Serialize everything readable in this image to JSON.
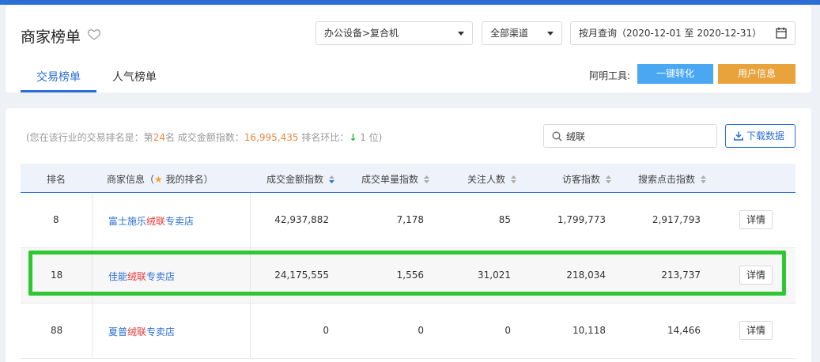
{
  "header": {
    "title": "商家榜单",
    "category_select": "办公设备>复合机",
    "channel_select": "全部渠道",
    "date_select": "按月查询（2020-12-01 至 2020-12-31）",
    "tabs": [
      {
        "label": "交易榜单",
        "active": true
      },
      {
        "label": "人气榜单",
        "active": false
      }
    ],
    "tools_label": "阿明工具:",
    "btn_convert": "一键转化",
    "btn_userinfo": "用户信息"
  },
  "summary": {
    "prefix": "(您在该行业的交易排名是：第",
    "rank": "24",
    "rank_suffix": "名   成交金额指数：",
    "amount": "16,995,435",
    "ratio_label": "   排名环比：",
    "ratio_arrow": "↓",
    "ratio_value": " 1 位)"
  },
  "search": {
    "value": "绒联"
  },
  "download_label": "下载数据",
  "table": {
    "headers": {
      "rank": "排名",
      "merchant": "商家信息（",
      "merchant_suffix": " 我的排名）",
      "amount": "成交金额指数",
      "orders": "成交单量指数",
      "followers": "关注人数",
      "visitors": "访客指数",
      "search_clicks": "搜索点击指数"
    },
    "rows": [
      {
        "rank": "8",
        "shop_pre": "富士施乐",
        "shop_kw": "绒联",
        "shop_post": "专卖店",
        "amount": "42,937,882",
        "orders": "7,178",
        "followers": "85",
        "visitors": "1,799,773",
        "search_clicks": "2,917,793",
        "detail": "详情"
      },
      {
        "rank": "18",
        "shop_pre": "佳能",
        "shop_kw": "绒联",
        "shop_post": "专卖店",
        "amount": "24,175,555",
        "orders": "1,556",
        "followers": "31,021",
        "visitors": "218,034",
        "search_clicks": "213,737",
        "detail": "详情"
      },
      {
        "rank": "88",
        "shop_pre": "夏普",
        "shop_kw": "绒联",
        "shop_post": "专卖店",
        "amount": "0",
        "orders": "0",
        "followers": "0",
        "visitors": "10,118",
        "search_clicks": "14,466",
        "detail": "详情"
      }
    ]
  },
  "colors": {
    "primary": "#2b6fd6",
    "highlight_box": "#2ec631",
    "orange": "#e8863d",
    "keyword": "#e63b3b"
  }
}
